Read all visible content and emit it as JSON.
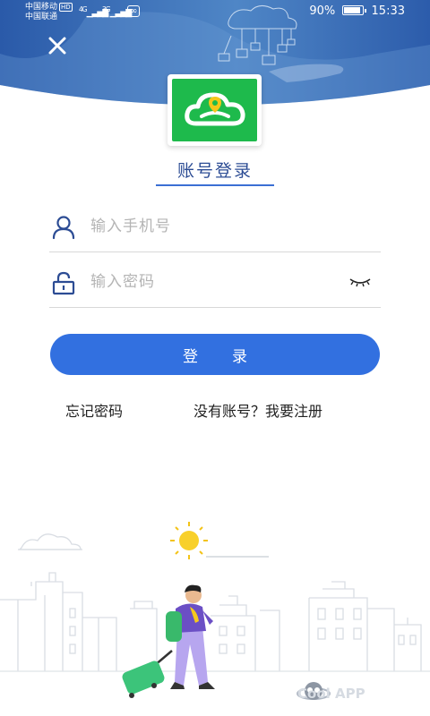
{
  "status_bar": {
    "carrier_1": "中国移动",
    "carrier_1_badge": "HD",
    "carrier_2": "中国联通",
    "signal_1_label": "4G",
    "signal_2_label": "3G",
    "battery_percent": "90%",
    "battery_level": 0.9,
    "time": "15:33"
  },
  "header": {
    "close_icon": "close-icon"
  },
  "title": "账号登录",
  "phone_field": {
    "placeholder": "输入手机号",
    "value": "",
    "icon": "user-icon"
  },
  "password_field": {
    "placeholder": "输入密码",
    "value": "",
    "icon": "lock-icon",
    "toggle_icon": "eye-closed-icon"
  },
  "login_button": "登录",
  "forgot_password": "忘记密码",
  "register": "没有账号？我要注册",
  "watermark": "Cool APP",
  "colors": {
    "primary_blue": "#3270e0",
    "title_blue": "#2c4c94",
    "logo_green": "#1eba4c",
    "banner_blue": "#2b5aa8"
  }
}
